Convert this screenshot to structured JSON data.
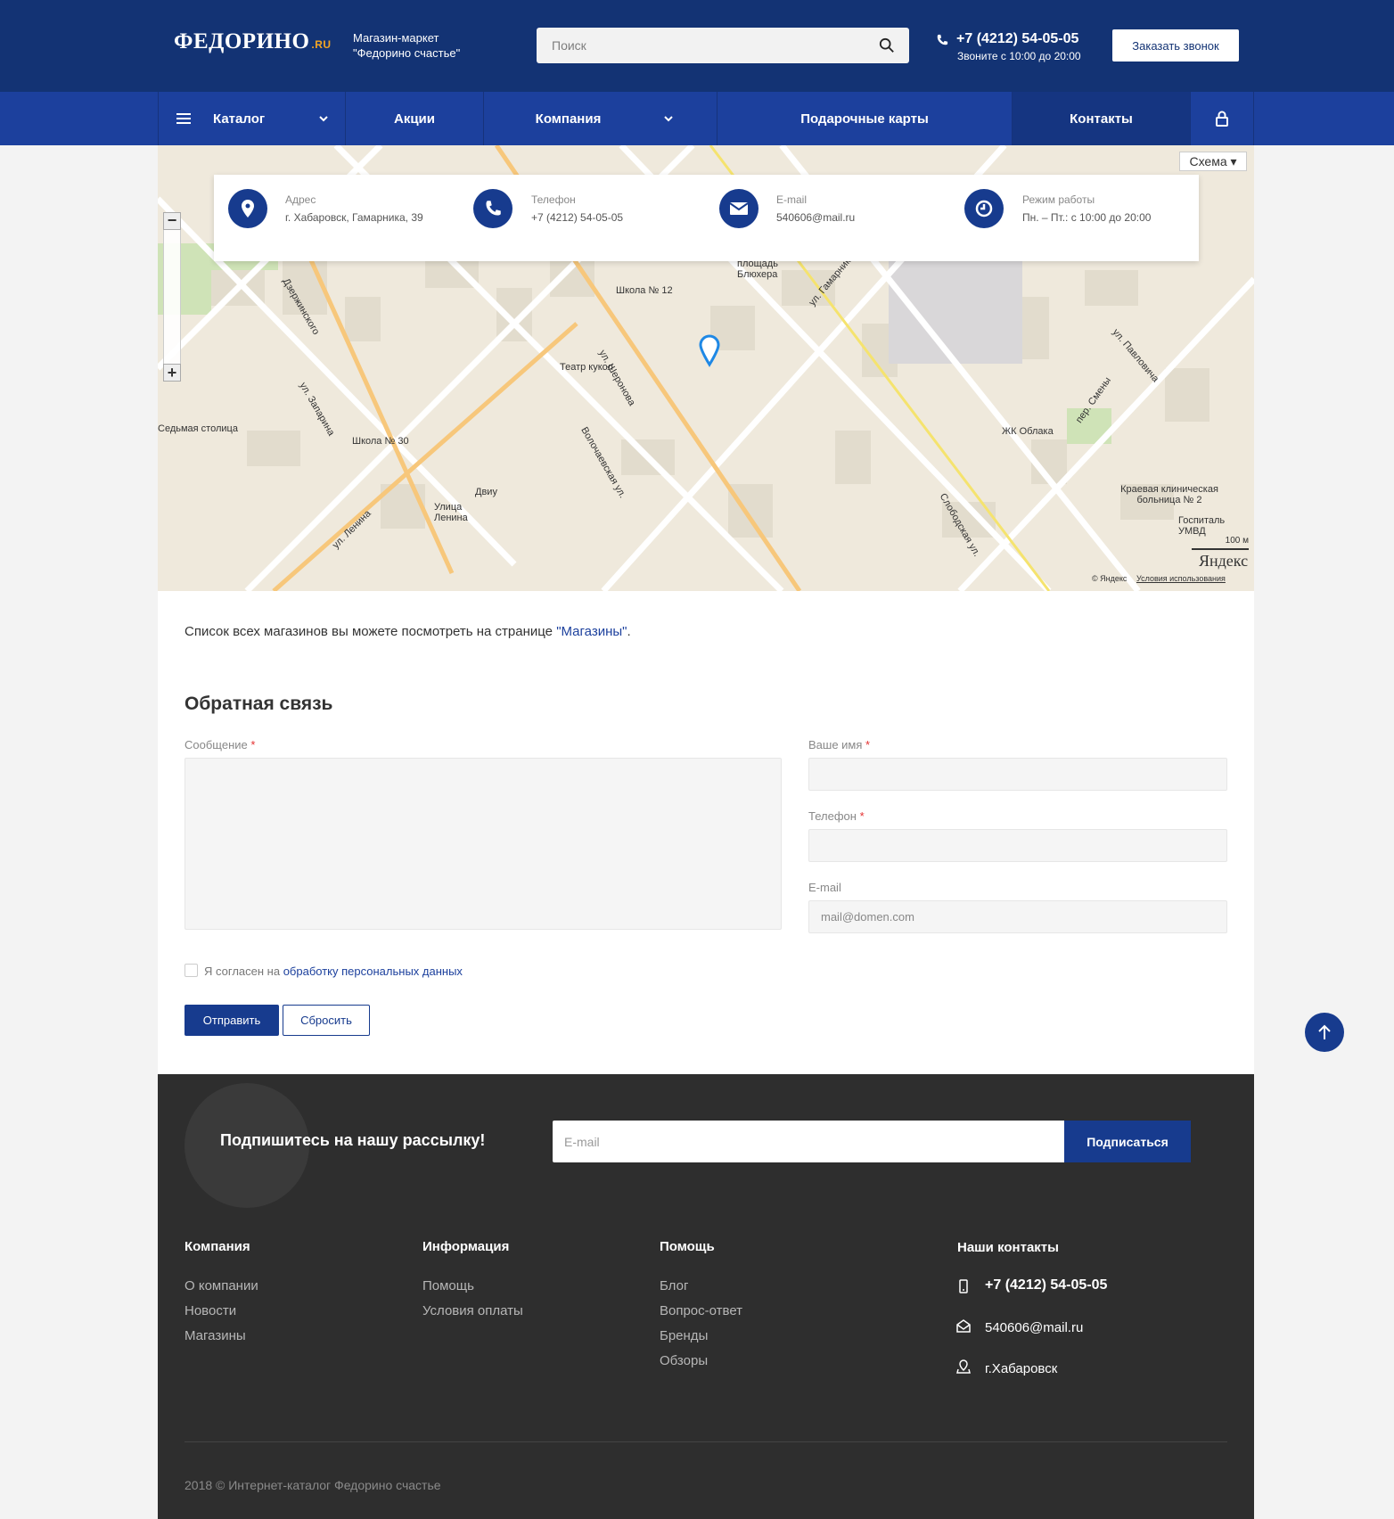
{
  "header": {
    "logo_text": "ФЕДОРИНО",
    "logo_suffix": ".RU",
    "slogan_line1": "Магазин-маркет",
    "slogan_line2": "\"Федорино счастье\"",
    "search_placeholder": "Поиск",
    "phone": "+7 (4212) 54-05-05",
    "phone_hours": "Звоните с 10:00 до 20:00",
    "callback_label": "Заказать звонок"
  },
  "nav": {
    "catalog": "Каталог",
    "promotions": "Акции",
    "company": "Компания",
    "gift_cards": "Подарочные карты",
    "contacts": "Контакты"
  },
  "map": {
    "mode_label": "Схема ▾",
    "scale": "100 м",
    "brand": "Яндекс",
    "copyright": "© Яндекс",
    "terms": "Условия использования",
    "labels": {
      "school12": "Школа № 12",
      "puppet": "Театр кукол",
      "school30": "Школа № 30",
      "seventh": "Седьмая столица",
      "lenin_st": "Улица Ленина",
      "dviu": "Двиу",
      "bluher": "площадь Блюхера",
      "oblaka": "ЖК Облака",
      "hospital": "Краевая клиническая больница № 2",
      "umvd": "Госпиталь УМВД",
      "volochaevskaya": "Волочаевская ул.",
      "sheronova": "ул. Шеронова",
      "lenina": "ул. Ленина",
      "zaparina": "ул. Запарина",
      "dzerzhinskogo": "Дзержинского",
      "slobodskaya": "Слободская ул.",
      "smeny": "пер. Смены",
      "pavlovicha": "ул. Павловича",
      "gamarnika": "ул. Гамарника"
    }
  },
  "contact_card": {
    "address_label": "Адрес",
    "address_value": "г. Хабаровск, Гамарника, 39",
    "phone_label": "Телефон",
    "phone_value": "+7 (4212) 54-05-05",
    "email_label": "E-mail",
    "email_value": "540606@mail.ru",
    "hours_label": "Режим работы",
    "hours_value": "Пн. – Пт.: с 10:00 до 20:00"
  },
  "stores_note": {
    "text": "Список всех магазинов вы можете посмотреть на странице ",
    "link": "\"Магазины\"",
    "end": "."
  },
  "feedback": {
    "title": "Обратная связь",
    "message_label": "Сообщение",
    "name_label": "Ваше имя",
    "phone_label": "Телефон",
    "email_label": "E-mail",
    "email_placeholder": "mail@domen.com",
    "required_mark": "*",
    "agree_text": "Я согласен на ",
    "agree_link": "обработку персональных данных",
    "send_label": "Отправить",
    "reset_label": "Сбросить"
  },
  "subscribe": {
    "title": "Подпишитесь на нашу рассылку!",
    "placeholder": "E-mail",
    "button": "Подписаться"
  },
  "footer": {
    "col1": {
      "title": "Компания",
      "links": [
        "О компании",
        "Новости",
        "Магазины"
      ]
    },
    "col2": {
      "title": "Информация",
      "links": [
        "Помощь",
        "Условия оплаты"
      ]
    },
    "col3": {
      "title": "Помощь",
      "links": [
        "Блог",
        "Вопрос-ответ",
        "Бренды",
        "Обзоры"
      ]
    },
    "contacts": {
      "title": "Наши контакты",
      "phone": "+7 (4212) 54-05-05",
      "email": "540606@mail.ru",
      "city": "г.Хабаровск"
    },
    "copyright": "2018 © Интернет-каталог Федорино счастье"
  },
  "colors": {
    "primary": "#133374",
    "nav": "#1c409d",
    "accent": "#173b8e",
    "footer": "#2e2e2e"
  }
}
